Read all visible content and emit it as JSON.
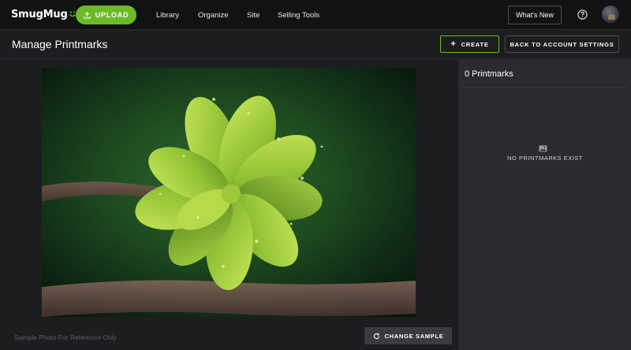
{
  "topbar": {
    "logo_text": "SmugMug",
    "upload_label": "UPLOAD",
    "nav_items": [
      {
        "id": "library",
        "label": "Library"
      },
      {
        "id": "organize",
        "label": "Organize"
      },
      {
        "id": "site",
        "label": "Site"
      },
      {
        "id": "selling-tools",
        "label": "Selling Tools"
      }
    ],
    "whats_new_label": "What's New",
    "help_icon": "question-circle-icon",
    "avatar_icon": "user-avatar"
  },
  "subheader": {
    "title": "Manage Printmarks",
    "create_label": "CREATE",
    "back_label": "BACK TO ACCOUNT SETTINGS"
  },
  "main": {
    "sample_note": "Sample Photo For Reference Only",
    "change_sample_label": "CHANGE SAMPLE"
  },
  "side_panel": {
    "count_label": "0 Printmarks",
    "empty_label": "NO PRINTMARKS EXIST",
    "empty_icon": "image-icon"
  },
  "colors": {
    "accent": "#6cba28",
    "topbar_bg": "#111213",
    "panel_bg": "#2a2b2e"
  }
}
